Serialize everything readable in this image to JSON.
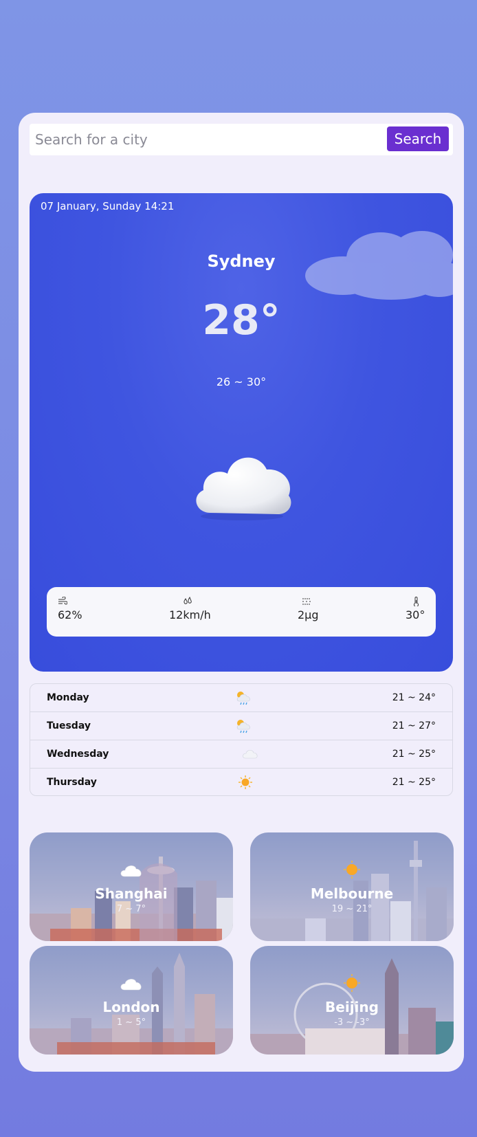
{
  "search": {
    "placeholder": "Search for a city",
    "button_label": "Search"
  },
  "current": {
    "datetime": "07 January, Sunday 14:21",
    "city": "Sydney",
    "temperature": "28°",
    "range": "26 ~ 30°",
    "condition_icon": "cloud-icon",
    "stats": [
      {
        "icon": "wind-icon",
        "value": "62%"
      },
      {
        "icon": "drops-icon",
        "value": "12km/h"
      },
      {
        "icon": "haze-icon",
        "value": "2μg"
      },
      {
        "icon": "thermometer-icon",
        "value": "30°"
      }
    ]
  },
  "forecast": [
    {
      "day": "Monday",
      "icon": "rain-cloud-icon",
      "range": "21 ~ 24°"
    },
    {
      "day": "Tuesday",
      "icon": "rain-cloud-icon",
      "range": "21 ~ 27°"
    },
    {
      "day": "Wednesday",
      "icon": "cloud-icon",
      "range": "21 ~ 25°"
    },
    {
      "day": "Thursday",
      "icon": "sun-icon",
      "range": "21 ~ 25°"
    }
  ],
  "cities": [
    {
      "name": "Shanghai",
      "range": "7 ~ 7°",
      "icon": "cloud-icon"
    },
    {
      "name": "Melbourne",
      "range": "19 ~ 21°",
      "icon": "sun-icon"
    },
    {
      "name": "London",
      "range": "1 ~ 5°",
      "icon": "cloud-icon"
    },
    {
      "name": "Beijing",
      "range": "-3 ~ -3°",
      "icon": "sun-icon"
    }
  ],
  "colors": {
    "accent": "#6a2fd0",
    "card": "#3f55e0",
    "panel": "#f1eefb"
  }
}
